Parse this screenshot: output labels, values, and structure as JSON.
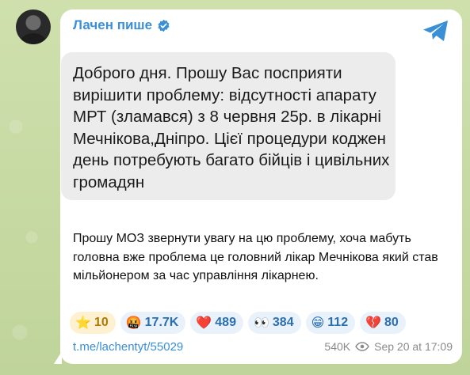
{
  "post": {
    "channel_name": "Лачен пише",
    "quote": "Доброго дня. Прошу Вас посприяти вирішити проблему: відсутності апарату МРТ (зламався) з 8 червня 25р. в лікарні Мечнікова,Дніпро. Цієї процедури коджен день потребують багато бійців і цивільних громадян",
    "body": "Прошу МОЗ звернути увагу на цю проблему, хоча мабуть головна вже проблема це головний лікар Мечнікова який став мільйонером за час управління лікарнею.",
    "reactions": [
      {
        "emoji": "⭐",
        "count": "10"
      },
      {
        "emoji": "🤬",
        "count": "17.7K"
      },
      {
        "emoji": "❤️",
        "count": "489"
      },
      {
        "emoji": "👀",
        "count": "384"
      },
      {
        "emoji": "😁",
        "count": "112"
      },
      {
        "emoji": "💔",
        "count": "80"
      }
    ],
    "link": "t.me/lachentyt/55029",
    "views": "540K",
    "timestamp": "Sep 20 at 17:09"
  },
  "icons": {
    "verified": "verified-badge-icon",
    "share": "telegram-share-icon",
    "views": "eye-icon"
  },
  "colors": {
    "accent": "#3a8fd6",
    "reaction_bg": "#e9f1fa",
    "quote_bg": "#ececec"
  }
}
